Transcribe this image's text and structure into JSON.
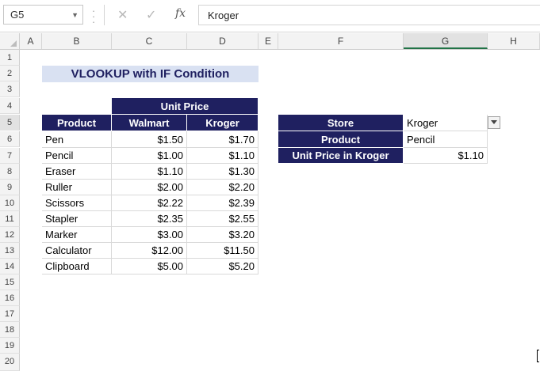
{
  "formula_bar": {
    "name_box": "G5",
    "cancel_icon": "✕",
    "enter_icon": "✓",
    "fx_label": "fx",
    "formula": "Kroger"
  },
  "columns": [
    "A",
    "B",
    "C",
    "D",
    "E",
    "F",
    "G",
    "H"
  ],
  "rows": [
    "1",
    "2",
    "3",
    "4",
    "5",
    "6",
    "7",
    "8",
    "9",
    "10",
    "11",
    "12",
    "13",
    "14",
    "15",
    "16",
    "17",
    "18",
    "19",
    "20"
  ],
  "sheet": {
    "title": "VLOOKUP with IF Condition",
    "unit_price_header": "Unit Price",
    "headers": {
      "product": "Product",
      "walmart": "Walmart",
      "kroger": "Kroger"
    },
    "products": [
      {
        "name": "Pen",
        "walmart": "$1.50",
        "kroger": "$1.70"
      },
      {
        "name": "Pencil",
        "walmart": "$1.00",
        "kroger": "$1.10"
      },
      {
        "name": "Eraser",
        "walmart": "$1.10",
        "kroger": "$1.30"
      },
      {
        "name": "Ruller",
        "walmart": "$2.00",
        "kroger": "$2.20"
      },
      {
        "name": "Scissors",
        "walmart": "$2.22",
        "kroger": "$2.39"
      },
      {
        "name": "Stapler",
        "walmart": "$2.35",
        "kroger": "$2.55"
      },
      {
        "name": "Marker",
        "walmart": "$3.00",
        "kroger": "$3.20"
      },
      {
        "name": "Calculator",
        "walmart": "$12.00",
        "kroger": "$11.50"
      },
      {
        "name": "Clipboard",
        "walmart": "$5.00",
        "kroger": "$5.20"
      }
    ],
    "lookup": {
      "store_label": "Store",
      "store_value": "Kroger",
      "product_label": "Product",
      "product_value": "Pencil",
      "result_label": "Unit Price in Kroger",
      "result_value": "$1.10"
    }
  },
  "colors": {
    "header_fill": "#1f2060",
    "title_fill": "#d9e1f2"
  },
  "icons": {
    "dropdown": "chevron-down-icon"
  }
}
